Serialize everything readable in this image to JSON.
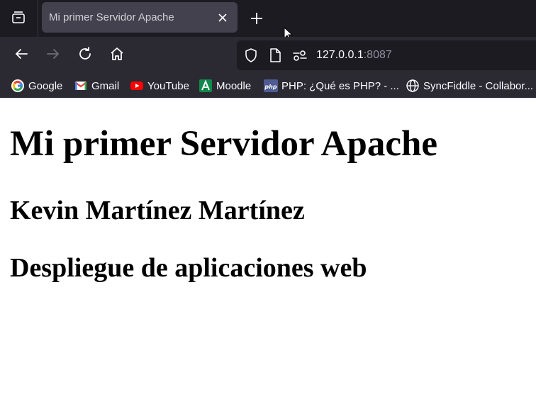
{
  "colors": {
    "tabstrip": "#1c1b22",
    "toolbar": "#2b2a33",
    "active_tab": "#42414d",
    "urlbar": "#1c1b22",
    "text_light": "#fbfbfe",
    "text_dim": "#8f8f9d"
  },
  "browser": {
    "tab_list_icon": "tab-list-icon",
    "tabs": [
      {
        "title": "Mi primer Servidor Apache",
        "active": true,
        "icon": "close-icon"
      }
    ],
    "new_tab_icon": "plus-icon",
    "nav": {
      "back_icon": "back-arrow-icon",
      "forward_icon": "forward-arrow-icon",
      "reload_icon": "reload-icon",
      "home_icon": "home-icon"
    },
    "urlbar": {
      "host": "127.0.0.1",
      "port": ":8087",
      "icons": [
        "shield-icon",
        "page-icon",
        "permissions-icon"
      ]
    },
    "bookmarks": [
      {
        "label": "Google",
        "icon": "google-icon"
      },
      {
        "label": "Gmail",
        "icon": "gmail-icon"
      },
      {
        "label": "YouTube",
        "icon": "youtube-icon"
      },
      {
        "label": "Moodle",
        "icon": "moodle-icon"
      },
      {
        "label": "PHP: ¿Qué es PHP? - ...",
        "icon": "php-icon"
      },
      {
        "label": "SyncFiddle - Collabor...",
        "icon": "globe-icon"
      }
    ]
  },
  "page": {
    "heading": "Mi primer Servidor Apache",
    "subheadings": [
      "Kevin Martínez Martínez",
      "Despliegue de aplicaciones web"
    ]
  }
}
